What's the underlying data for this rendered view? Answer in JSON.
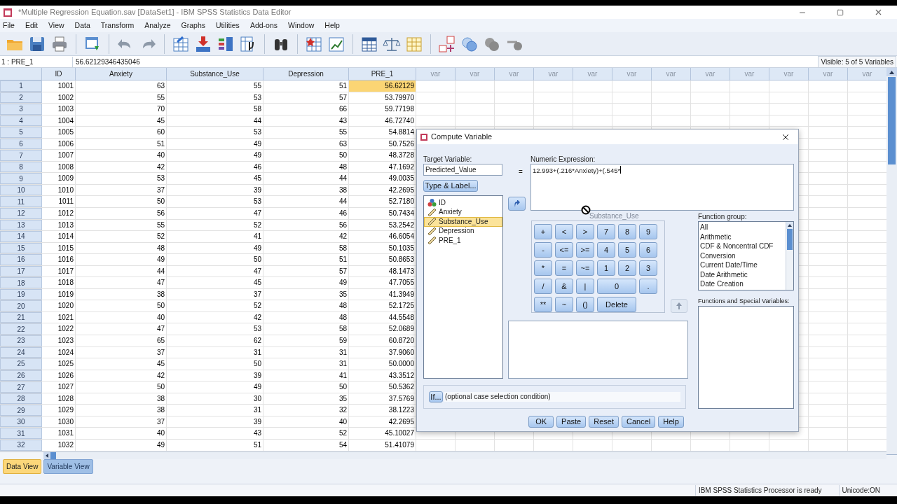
{
  "window": {
    "title": "*Multiple Regression Equation.sav [DataSet1] - IBM SPSS Statistics Data Editor"
  },
  "menu": [
    "File",
    "Edit",
    "View",
    "Data",
    "Transform",
    "Analyze",
    "Graphs",
    "Utilities",
    "Add-ons",
    "Window",
    "Help"
  ],
  "cell_editor": {
    "cell": "1 : PRE_1",
    "value": "56.62129346435046",
    "visible": "Visible: 5 of 5 Variables"
  },
  "grid": {
    "columns": [
      "ID",
      "Anxiety",
      "Substance_Use",
      "Depression",
      "PRE_1",
      "var",
      "var",
      "var",
      "var",
      "var",
      "var",
      "var",
      "var",
      "var",
      "var",
      "var",
      "var"
    ],
    "rows": [
      {
        "n": "1",
        "cells": [
          "1001",
          "63",
          "55",
          "51",
          "56.62129"
        ],
        "selected": true
      },
      {
        "n": "2",
        "cells": [
          "1002",
          "55",
          "53",
          "57",
          "53.79970"
        ],
        "selected": false
      },
      {
        "n": "3",
        "cells": [
          "1003",
          "70",
          "58",
          "66",
          "59.77198"
        ],
        "selected": false
      },
      {
        "n": "4",
        "cells": [
          "1004",
          "45",
          "44",
          "43",
          "46.72740"
        ],
        "selected": false
      },
      {
        "n": "5",
        "cells": [
          "1005",
          "60",
          "53",
          "55",
          "54.8814"
        ],
        "selected": false
      },
      {
        "n": "6",
        "cells": [
          "1006",
          "51",
          "49",
          "63",
          "50.7526"
        ],
        "selected": false
      },
      {
        "n": "7",
        "cells": [
          "1007",
          "40",
          "49",
          "50",
          "48.3728"
        ],
        "selected": false
      },
      {
        "n": "8",
        "cells": [
          "1008",
          "42",
          "46",
          "48",
          "47.1692"
        ],
        "selected": false
      },
      {
        "n": "9",
        "cells": [
          "1009",
          "53",
          "45",
          "44",
          "49.0035"
        ],
        "selected": false
      },
      {
        "n": "10",
        "cells": [
          "1010",
          "37",
          "39",
          "38",
          "42.2695"
        ],
        "selected": false
      },
      {
        "n": "11",
        "cells": [
          "1011",
          "50",
          "53",
          "44",
          "52.7180"
        ],
        "selected": false
      },
      {
        "n": "12",
        "cells": [
          "1012",
          "56",
          "47",
          "46",
          "50.7434"
        ],
        "selected": false
      },
      {
        "n": "13",
        "cells": [
          "1013",
          "55",
          "52",
          "56",
          "53.2542"
        ],
        "selected": false
      },
      {
        "n": "14",
        "cells": [
          "1014",
          "52",
          "41",
          "42",
          "46.6054"
        ],
        "selected": false
      },
      {
        "n": "15",
        "cells": [
          "1015",
          "48",
          "49",
          "58",
          "50.1035"
        ],
        "selected": false
      },
      {
        "n": "16",
        "cells": [
          "1016",
          "49",
          "50",
          "51",
          "50.8653"
        ],
        "selected": false
      },
      {
        "n": "17",
        "cells": [
          "1017",
          "44",
          "47",
          "57",
          "48.1473"
        ],
        "selected": false
      },
      {
        "n": "18",
        "cells": [
          "1018",
          "47",
          "45",
          "49",
          "47.7055"
        ],
        "selected": false
      },
      {
        "n": "19",
        "cells": [
          "1019",
          "38",
          "37",
          "35",
          "41.3949"
        ],
        "selected": false
      },
      {
        "n": "20",
        "cells": [
          "1020",
          "50",
          "52",
          "48",
          "52.1725"
        ],
        "selected": false
      },
      {
        "n": "21",
        "cells": [
          "1021",
          "40",
          "42",
          "48",
          "44.5548"
        ],
        "selected": false
      },
      {
        "n": "22",
        "cells": [
          "1022",
          "47",
          "53",
          "58",
          "52.0689"
        ],
        "selected": false
      },
      {
        "n": "23",
        "cells": [
          "1023",
          "65",
          "62",
          "59",
          "60.8720"
        ],
        "selected": false
      },
      {
        "n": "24",
        "cells": [
          "1024",
          "37",
          "31",
          "31",
          "37.9060"
        ],
        "selected": false
      },
      {
        "n": "25",
        "cells": [
          "1025",
          "45",
          "50",
          "31",
          "50.0000"
        ],
        "selected": false
      },
      {
        "n": "26",
        "cells": [
          "1026",
          "42",
          "39",
          "41",
          "43.3512"
        ],
        "selected": false
      },
      {
        "n": "27",
        "cells": [
          "1027",
          "50",
          "49",
          "50",
          "50.5362"
        ],
        "selected": false
      },
      {
        "n": "28",
        "cells": [
          "1028",
          "38",
          "30",
          "35",
          "37.5769"
        ],
        "selected": false
      },
      {
        "n": "29",
        "cells": [
          "1029",
          "38",
          "31",
          "32",
          "38.1223"
        ],
        "selected": false
      },
      {
        "n": "30",
        "cells": [
          "1030",
          "37",
          "39",
          "40",
          "42.2695"
        ],
        "selected": false
      },
      {
        "n": "31",
        "cells": [
          "1031",
          "40",
          "43",
          "52",
          "45.10027"
        ],
        "selected": false
      },
      {
        "n": "32",
        "cells": [
          "1032",
          "49",
          "51",
          "54",
          "51.41079"
        ],
        "selected": false
      }
    ]
  },
  "dialog": {
    "title": "Compute Variable",
    "target_label": "Target Variable:",
    "target_value": "Predicted_Value",
    "type_label_button": "Type & Label...",
    "equals": "=",
    "expression_label": "Numeric Expression:",
    "expression": "12.993+(.216*Anxiety)+(.545*",
    "variables": [
      {
        "name": "ID",
        "kind": "nominal",
        "selected": false
      },
      {
        "name": "Anxiety",
        "kind": "scale",
        "selected": false
      },
      {
        "name": "Substance_Use",
        "kind": "scale",
        "selected": true
      },
      {
        "name": "Depression",
        "kind": "scale",
        "selected": false
      },
      {
        "name": "PRE_1",
        "kind": "scale",
        "selected": false
      }
    ],
    "drag_ghost": "Substance_Use",
    "keypad": [
      [
        {
          "label": "+",
          "kind": "key"
        },
        {
          "label": "<",
          "kind": "key"
        },
        {
          "label": ">",
          "kind": "key"
        },
        {
          "label": "7",
          "kind": "key"
        },
        {
          "label": "8",
          "kind": "key"
        },
        {
          "label": "9",
          "kind": "key"
        }
      ],
      [
        {
          "label": "-",
          "kind": "key"
        },
        {
          "label": "<=",
          "kind": "key"
        },
        {
          "label": ">=",
          "kind": "key"
        },
        {
          "label": "4",
          "kind": "key"
        },
        {
          "label": "5",
          "kind": "key"
        },
        {
          "label": "6",
          "kind": "key"
        }
      ],
      [
        {
          "label": "*",
          "kind": "key"
        },
        {
          "label": "=",
          "kind": "key"
        },
        {
          "label": "~=",
          "kind": "key"
        },
        {
          "label": "1",
          "kind": "key"
        },
        {
          "label": "2",
          "kind": "key"
        },
        {
          "label": "3",
          "kind": "key"
        }
      ],
      [
        {
          "label": "/",
          "kind": "key"
        },
        {
          "label": "&",
          "kind": "key"
        },
        {
          "label": "|",
          "kind": "key"
        },
        {
          "label": "0",
          "kind": "wide"
        },
        {
          "label": ".",
          "kind": "key"
        }
      ],
      [
        {
          "label": "**",
          "kind": "key"
        },
        {
          "label": "~",
          "kind": "key"
        },
        {
          "label": "()",
          "kind": "key"
        },
        {
          "label": "Delete",
          "kind": "wide"
        }
      ]
    ],
    "function_group_label": "Function group:",
    "function_groups": [
      "All",
      "Arithmetic",
      "CDF & Noncentral CDF",
      "Conversion",
      "Current Date/Time",
      "Date Arithmetic",
      "Date Creation"
    ],
    "functions_label": "Functions and Special Variables:",
    "if_button": "If...",
    "if_text": "(optional case selection condition)",
    "buttons": [
      "OK",
      "Paste",
      "Reset",
      "Cancel",
      "Help"
    ]
  },
  "tabs": [
    {
      "label": "Data View",
      "selected": true
    },
    {
      "label": "Variable View",
      "selected": false
    }
  ],
  "status_bar": [
    "IBM SPSS Statistics Processor is ready",
    "Unicode:ON"
  ]
}
